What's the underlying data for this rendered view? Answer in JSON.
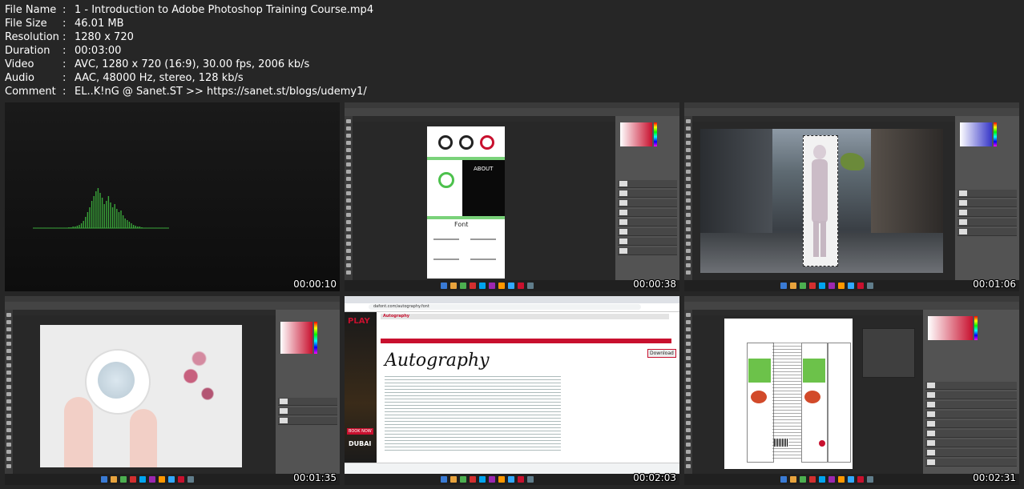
{
  "info": [
    {
      "label": "File Name",
      "value": "1 - Introduction to Adobe Photoshop Training Course.mp4"
    },
    {
      "label": "File Size",
      "value": "46.01 MB"
    },
    {
      "label": "Resolution",
      "value": "1280 x 720"
    },
    {
      "label": "Duration",
      "value": "00:03:00"
    },
    {
      "label": "Video",
      "value": "AVC, 1280 x 720 (16:9), 30.00 fps, 2006 kb/s"
    },
    {
      "label": "Audio",
      "value": "AAC, 48000 Hz, stereo, 128 kb/s"
    },
    {
      "label": "Comment",
      "value": "EL..K!nG @ Sanet.ST >> https://sanet.st/blogs/udemy1/"
    }
  ],
  "separator": ":",
  "thumbs": [
    {
      "timestamp": "00:00:10"
    },
    {
      "timestamp": "00:00:38",
      "about": "ABOUT",
      "font": "Font"
    },
    {
      "timestamp": "00:01:06"
    },
    {
      "timestamp": "00:01:35"
    },
    {
      "timestamp": "00:02:03",
      "site": "Autography",
      "url": "dafont.com/autography.font",
      "play": "PLAY",
      "book": "BOOK NOW",
      "city": "DUBAI",
      "download": "Download",
      "script": "Autography"
    },
    {
      "timestamp": "00:02:31"
    }
  ],
  "colors": {
    "bg": "#262626",
    "ps_dark": "#535353",
    "wave": "#3aa63a",
    "accent": "#c8102e"
  }
}
